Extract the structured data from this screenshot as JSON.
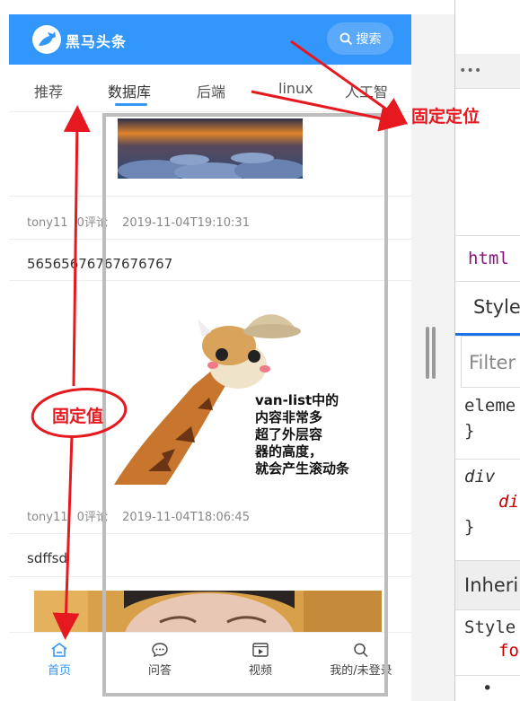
{
  "app": {
    "brand": "黑马头条",
    "search_label": "搜索"
  },
  "channels": [
    "推荐",
    "数据库",
    "后端",
    "linux",
    "人工智"
  ],
  "active_channel_index": 1,
  "articles": [
    {
      "author": "tony11",
      "comments": "0评论",
      "time": "2019-11-04T19:10:31"
    },
    {
      "title": "56565676767676767",
      "author": "tony11",
      "comments": "0评论",
      "time": "2019-11-04T18:06:45"
    },
    {
      "title": "sdffsd"
    }
  ],
  "tabbar": [
    {
      "label": "首页",
      "icon": "home-icon",
      "active": true
    },
    {
      "label": "问答",
      "icon": "chat-icon",
      "active": false
    },
    {
      "label": "视频",
      "icon": "video-icon",
      "active": false
    },
    {
      "label": "我的/未登录",
      "icon": "search-icon",
      "active": false
    }
  ],
  "devtools": {
    "dots": "•••",
    "html_tab": "html",
    "styles_tab": "Style",
    "filter_placeholder": "Filter",
    "rule1_selector": "eleme",
    "rule1_close": "}",
    "rule2_selector": "div",
    "rule2_prop": "di",
    "rule2_close": "}",
    "inherited": "Inheri",
    "styles_row": "Style",
    "prop_fo": "fo",
    "dot": "•"
  },
  "annotations": {
    "fixed_position": "固定定位",
    "fixed_value": "固定值",
    "callout_lines": [
      "van-list中的",
      "内容非常多",
      "超了外层容",
      "器的高度，",
      "就会产生滚动条"
    ]
  },
  "colors": {
    "brand_blue": "#3296fa",
    "annotation_red": "#e5191f",
    "frame_gray": "#bdbdbd"
  }
}
